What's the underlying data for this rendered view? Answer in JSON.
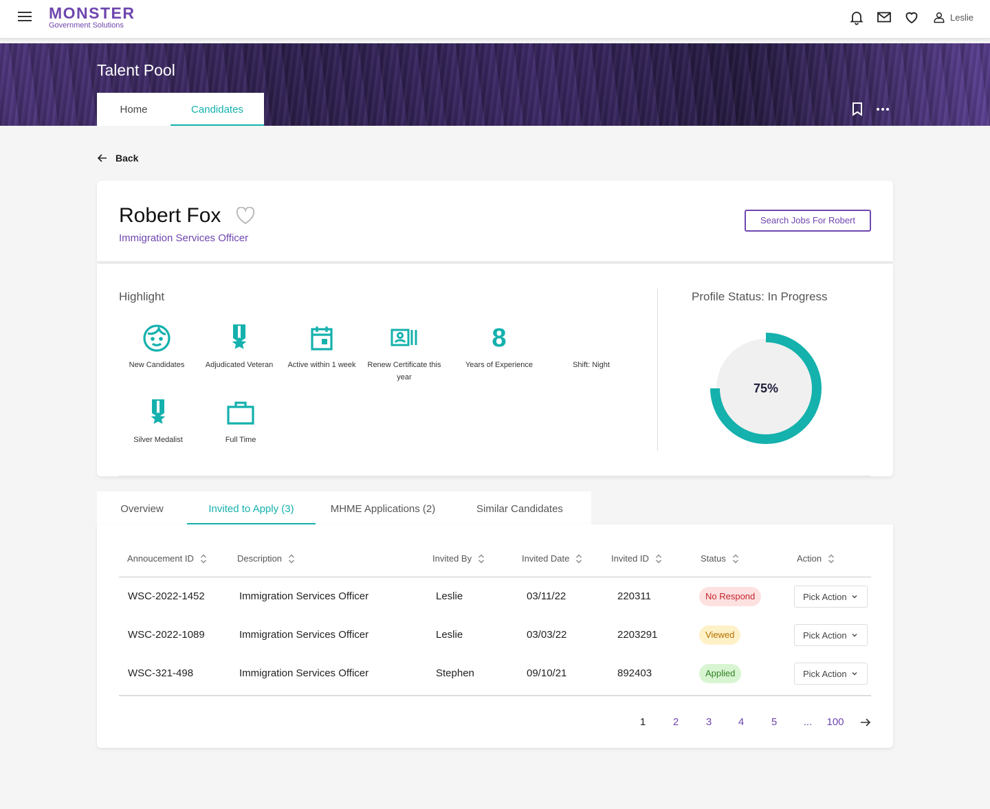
{
  "header": {
    "logo_main": "MONSTER",
    "logo_sub": "Government Solutions",
    "user_name": "Leslie",
    "icons": [
      "menu-icon",
      "bell-icon",
      "mail-icon",
      "heart-icon",
      "user-icon"
    ]
  },
  "banner": {
    "title": "Talent Pool",
    "tabs": [
      {
        "label": "Home"
      },
      {
        "label": "Candidates",
        "active": true
      }
    ]
  },
  "back_label": "Back",
  "profile": {
    "name": "Robert Fox",
    "title": "Immigration Services Officer",
    "search_button": "Search Jobs For Robert"
  },
  "highlight": {
    "title": "Highlight",
    "items": [
      {
        "label": "New Candidates",
        "icon": "face-icon"
      },
      {
        "label": "Adjudicated Veteran",
        "icon": "medal-icon"
      },
      {
        "label": "Active within 1 week",
        "icon": "calendar-icon"
      },
      {
        "label": "Renew Certificate this year",
        "icon": "certificate-icon"
      },
      {
        "label": "Years of Experience",
        "value": "8"
      },
      {
        "label": "Shift: Night",
        "icon": "moon-icon"
      },
      {
        "label": "Silver Medalist",
        "icon": "medal-icon"
      },
      {
        "label": "Full Time",
        "icon": "briefcase-icon"
      }
    ]
  },
  "profile_status": {
    "title": "Profile Status: In Progress",
    "percent_label": "75%",
    "progress": 0.75,
    "color": "#14b1ad",
    "track_color": "#f0f0f0"
  },
  "tabs": [
    {
      "label": "Overview"
    },
    {
      "label": "Invited to Apply (3)",
      "active": true
    },
    {
      "label": "MHME Applications (2)"
    },
    {
      "label": "Similar Candidates"
    }
  ],
  "table": {
    "columns": [
      "Annoucement ID",
      "Description",
      "Invited By",
      "Invited Date",
      "Invited ID",
      "Status",
      "Action"
    ],
    "rows": [
      {
        "announcement_id": "WSC-2022-1452",
        "description": "Immigration Services Officer",
        "invited_by": "Leslie",
        "invited_date": "03/11/22",
        "invited_id": "220311",
        "status": "No Respond",
        "status_color": "#c4232c",
        "action": "Pick Action"
      },
      {
        "announcement_id": "WSC-2022-1089",
        "description": "Immigration Services Officer",
        "invited_by": "Leslie",
        "invited_date": "03/03/22",
        "invited_id": "2203291",
        "status": "Viewed",
        "status_color": "#b06d00",
        "action": "Pick Action"
      },
      {
        "announcement_id": "WSC-321-498",
        "description": "Immigration Services Officer",
        "invited_by": "Stephen",
        "invited_date": "09/10/21",
        "invited_id": "892403",
        "status": "Applied",
        "status_color": "#2f7f22",
        "action": "Pick Action"
      }
    ]
  },
  "pagination": {
    "pages": [
      "1",
      "2",
      "3",
      "4",
      "5",
      "...",
      "100"
    ],
    "current": "1"
  },
  "colors": {
    "brand_purple": "#6e46ae",
    "accent_teal": "#14b1ad"
  }
}
